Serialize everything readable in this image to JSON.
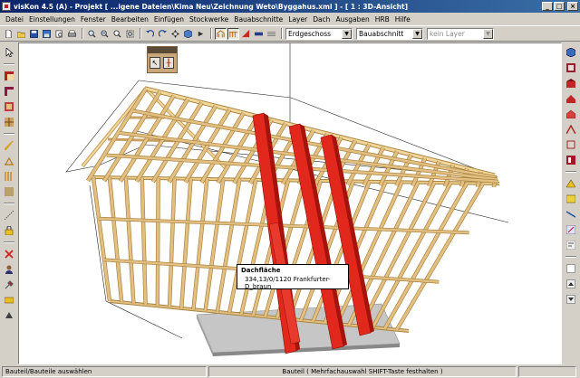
{
  "window": {
    "title": "visKon 4.5 (A) - Projekt [ ...igene Dateien\\Kima Neu\\Zeichnung Weto\\Byggahus.xml ] - [ 1 : 3D-Ansicht]",
    "min_glyph": "_",
    "max_glyph": "□",
    "close_glyph": "×"
  },
  "menu": [
    "Datei",
    "Einstellungen",
    "Fenster",
    "Bearbeiten",
    "Einfügen",
    "Stockwerke",
    "Bauabschnitte",
    "Layer",
    "Dach",
    "Ausgaben",
    "HRB",
    "Hilfe"
  ],
  "toolbar": {
    "floor_select": "Erdgeschoss",
    "section_select": "Bauabschnitt",
    "layer_select": "kein Layer",
    "dropdown_arrow": "▼"
  },
  "snap_palette": {
    "cursor_glyph": "↖",
    "grid_glyph": "╫"
  },
  "tooltip": {
    "title": "Dachfläche",
    "detail": "334,13/0/1120 Frankfurter-D_braun"
  },
  "status": {
    "left": "Bauteil/Bauteile auswählen",
    "center": "Bauteil ( Mehrfachauswahl SHIFT-Taste festhalten )",
    "right": ""
  },
  "colors": {
    "timber": "#e3c082",
    "timber_edge": "#a9833f",
    "highlight_red": "#e2271d",
    "slab": "#bdbdbd",
    "window_title": "#0a246a",
    "chrome": "#d4d0c8"
  },
  "icons": {
    "toolbar": [
      "new-file-icon",
      "open-file-icon",
      "save-icon",
      "save-as-icon",
      "print-preview-icon",
      "print-icon",
      "zoom-in-icon",
      "zoom-out-icon",
      "zoom-window-icon",
      "zoom-all-icon",
      "undo-icon",
      "redo-icon",
      "rotate-view-icon",
      "3d-cube-icon",
      "pan-icon",
      "timber-frame-icon",
      "roof-beam-icon",
      "roof-red-icon",
      "wall-icon",
      "layers-icon"
    ],
    "left": [
      "select-pointer-icon",
      "wall-layer-icon",
      "corner-icon",
      "window-icon",
      "door-icon",
      "beam-icon",
      "rafter-icon",
      "stud-icon",
      "panel-icon",
      "dimension-icon",
      "lock-icon",
      "delete-icon",
      "user-icon",
      "tool-icon",
      "sheet-icon",
      "rotate-icon"
    ],
    "right": [
      "3d-view-icon",
      "floor-plan-icon",
      "building-icon",
      "roof-icon",
      "house-icon",
      "cut-icon",
      "wall-section-icon",
      "elevation-icon",
      "solar-icon",
      "window-type-icon",
      "line-icon",
      "measure-icon",
      "3dl-icon",
      "blank-icon",
      "scroll-up-icon",
      "scroll-down-icon"
    ]
  }
}
